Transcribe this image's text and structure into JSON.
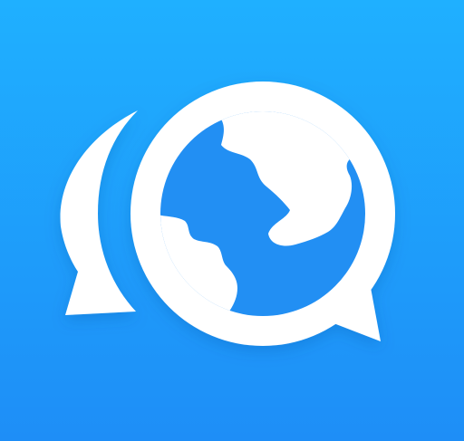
{
  "icon": {
    "name": "chat-globe-app-icon",
    "colors": {
      "background_top": "#1fb0ff",
      "background_bottom": "#1e8ef7",
      "foreground": "#ffffff",
      "globe_fill": "#228ff3"
    }
  }
}
